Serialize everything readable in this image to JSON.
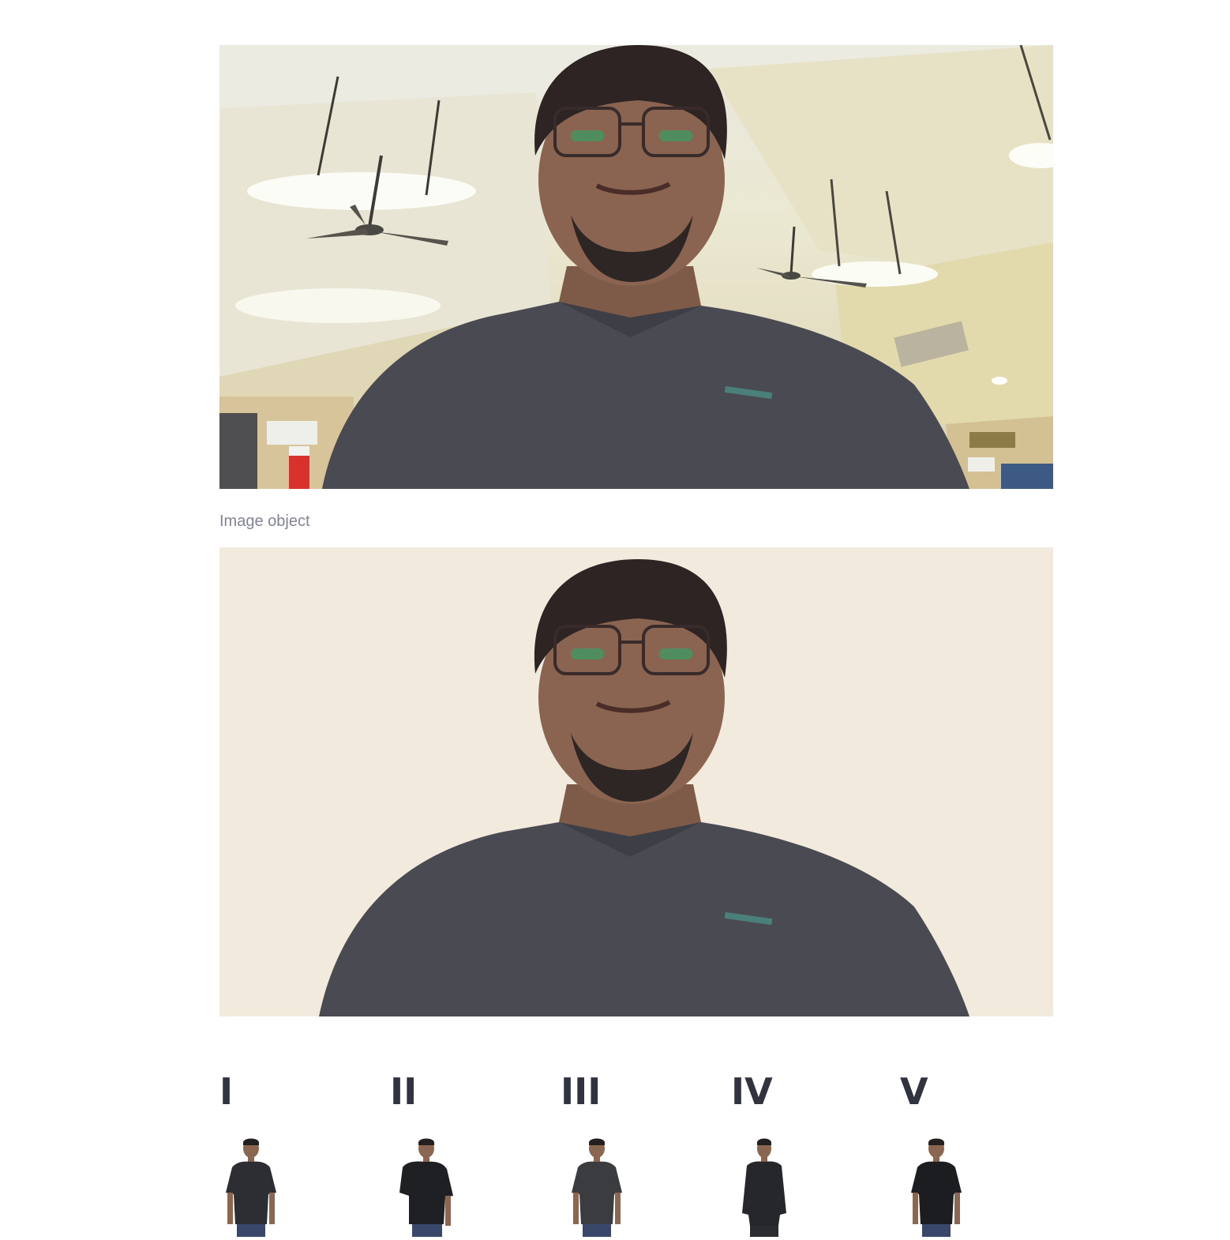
{
  "media": {
    "original_photo": {
      "icon": "webcam-photo-person-office",
      "description_kind": "photo"
    },
    "caption": "Image object",
    "segmented_photo": {
      "icon": "person-background-removed",
      "background_color": "#f2ebdd"
    }
  },
  "options": [
    {
      "label": "I",
      "shirt_color": "#2c2e33",
      "thumb_icon": "model-tshirt-icon"
    },
    {
      "label": "II",
      "shirt_color": "#1f2024",
      "thumb_icon": "model-polo-icon"
    },
    {
      "label": "III",
      "shirt_color": "#3a3c40",
      "thumb_icon": "model-tshirt-icon"
    },
    {
      "label": "IV",
      "shirt_color": "#25272b",
      "thumb_icon": "model-shirt-icon"
    },
    {
      "label": "V",
      "shirt_color": "#1c1d20",
      "thumb_icon": "model-tshirt-icon"
    }
  ],
  "colors": {
    "text_primary": "#31333f",
    "caption": "#808495"
  }
}
